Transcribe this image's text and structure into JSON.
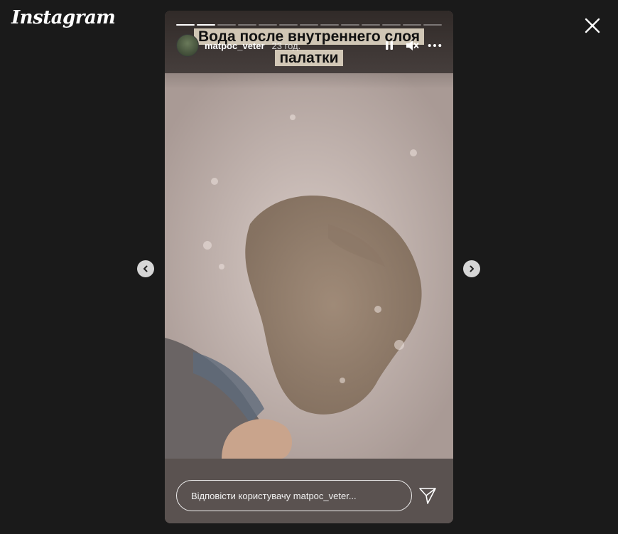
{
  "app": {
    "brand": "Instagram"
  },
  "story": {
    "username": "matpoc_veter",
    "time_ago": "23 год.",
    "caption_line1": "Вода после внутреннего слоя",
    "caption_line2": "палатки",
    "segments_total": 13,
    "segments_done": 1,
    "active_segment_progress": 1.0
  },
  "reply": {
    "placeholder": "Відповісти користувачу matpoc_veter..."
  },
  "icons": {
    "close": "close-icon",
    "prev": "chevron-left-icon",
    "next": "chevron-right-icon",
    "pause": "pause-icon",
    "mute": "muted-speaker-icon",
    "more": "more-horizontal-icon",
    "send": "send-icon"
  }
}
